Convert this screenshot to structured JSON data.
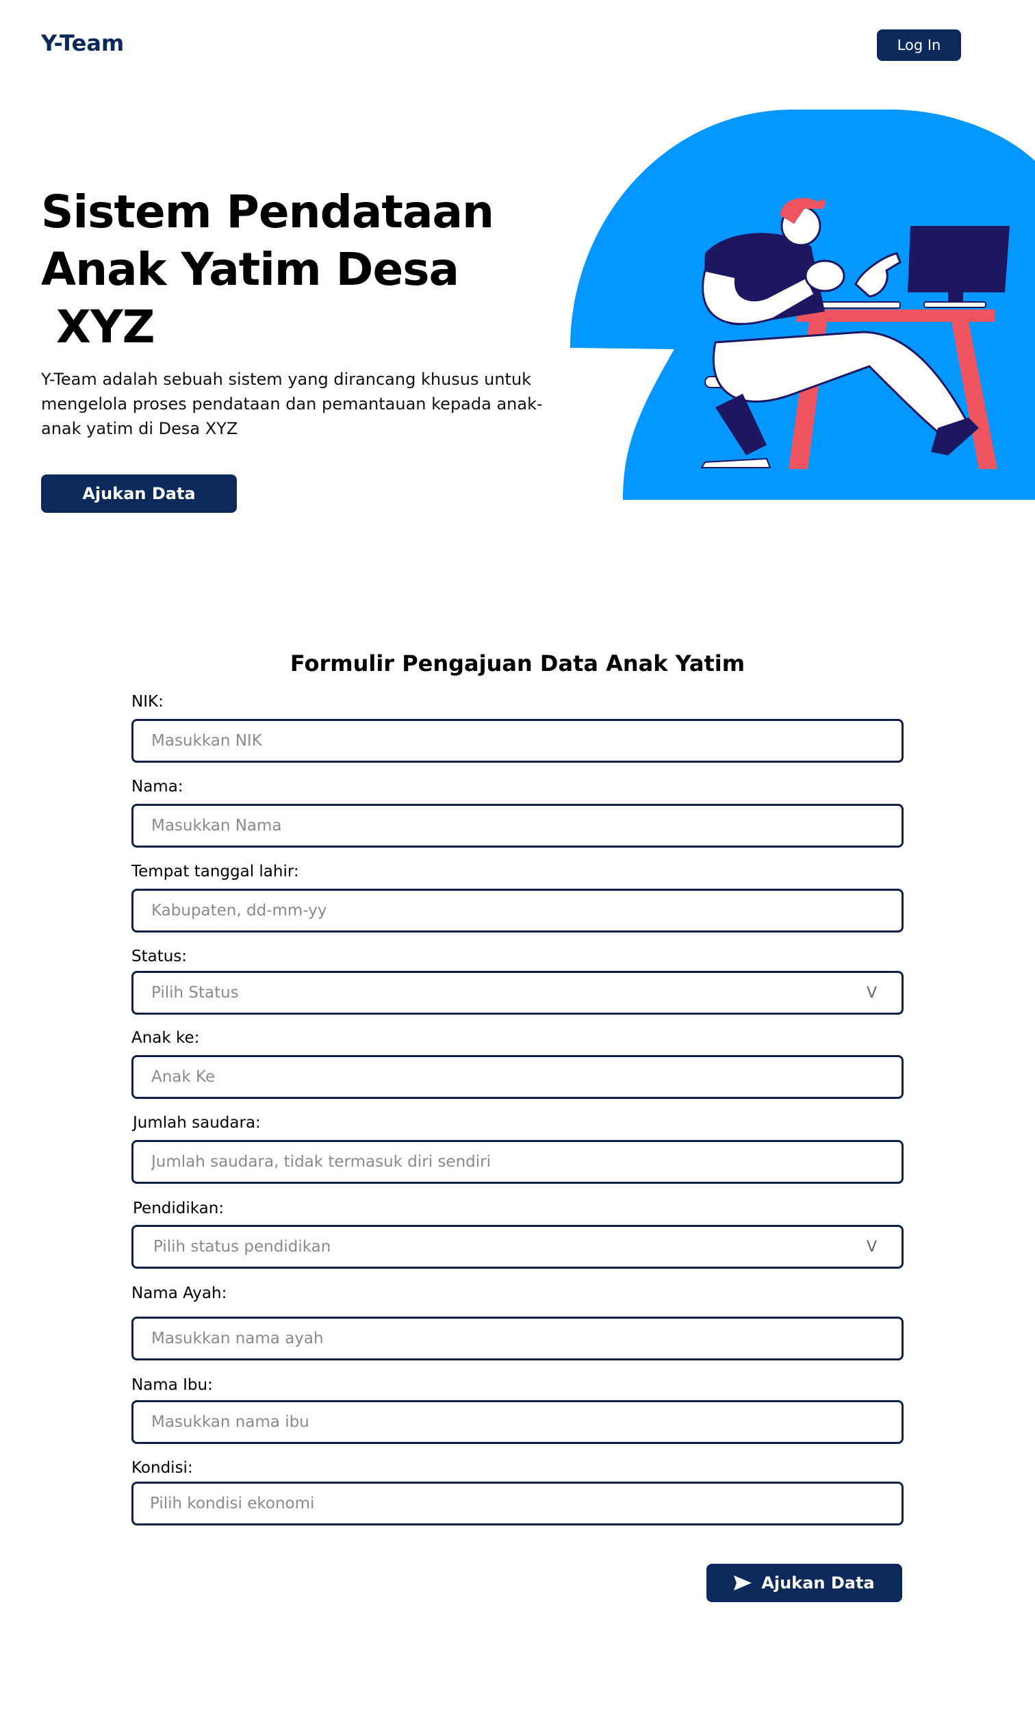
{
  "header": {
    "logo": "Y-Team",
    "login_label": "Log In"
  },
  "hero": {
    "title_line1": "Sistem Pendataan",
    "title_line2": "Anak Yatim Desa",
    "title_line3": " XYZ",
    "description": "Y-Team adalah sebuah sistem yang dirancang khusus untuk mengelola proses pendataan dan pemantauan kepada anak-anak yatim di Desa XYZ",
    "cta_label": "Ajukan Data"
  },
  "form": {
    "title": "Formulir Pengajuan Data Anak Yatim",
    "fields": {
      "nik": {
        "label": "NIK:",
        "placeholder": "Masukkan NIK"
      },
      "nama": {
        "label": "Nama:",
        "placeholder": "Masukkan Nama"
      },
      "ttl": {
        "label": "Tempat tanggal lahir:",
        "placeholder": "Kabupaten, dd-mm-yy"
      },
      "status": {
        "label": "Status:",
        "placeholder": "Pilih Status",
        "chevron": "V"
      },
      "anak_ke": {
        "label": "Anak ke:",
        "placeholder": "Anak Ke"
      },
      "jumlah_saudara": {
        "label": "Jumlah saudara:",
        "placeholder": "Jumlah saudara, tidak termasuk diri sendiri"
      },
      "pendidikan": {
        "label": "Pendidikan:",
        "placeholder": "Pilih status pendidikan",
        "chevron": "V"
      },
      "nama_ayah": {
        "label": "Nama Ayah:",
        "placeholder": "Masukkan nama ayah"
      },
      "nama_ibu": {
        "label": "Nama Ibu:",
        "placeholder": "Masukkan nama ibu"
      },
      "kondisi": {
        "label": "Kondisi:",
        "placeholder": "Pilih kondisi ekonomi"
      }
    },
    "submit_label": "Ajukan Data"
  },
  "colors": {
    "primary": "#0b2a5b",
    "hero_blue": "#0497ff",
    "desk_red": "#ee5561",
    "navy_dark": "#1c1760"
  },
  "icons": {
    "submit": "send-icon",
    "select": "chevron-down-icon"
  }
}
